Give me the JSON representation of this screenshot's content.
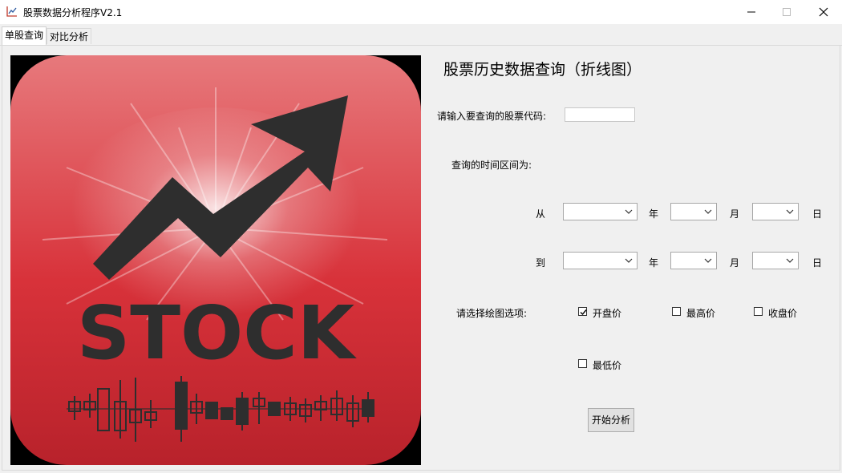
{
  "window": {
    "title": "股票数据分析程序V2.1"
  },
  "tabs": [
    {
      "label": "单股查询",
      "active": true
    },
    {
      "label": "对比分析",
      "active": false
    }
  ],
  "logo": {
    "text": "STOCK"
  },
  "form": {
    "heading": "股票历史数据查询（折线图）",
    "code_label": "请输入要查询的股票代码:",
    "code_value": "",
    "range_label": "查询的时间区间为:",
    "from_label": "从",
    "to_label": "到",
    "year_label": "年",
    "month_label": "月",
    "day_label": "日",
    "plot_options_label": "请选择绘图选项:",
    "options": [
      {
        "label": "开盘价",
        "checked": true
      },
      {
        "label": "最高价",
        "checked": false
      },
      {
        "label": "收盘价",
        "checked": false
      },
      {
        "label": "最低价",
        "checked": false
      }
    ],
    "start_button": "开始分析"
  }
}
